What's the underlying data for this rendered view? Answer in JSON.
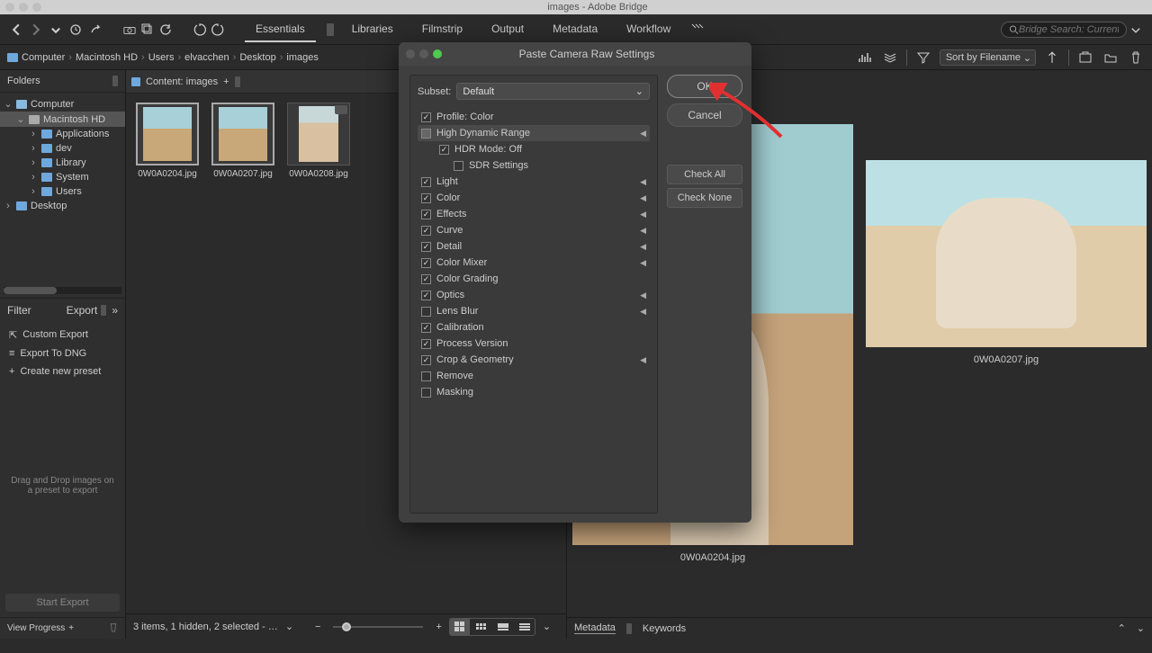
{
  "app": {
    "title": "images - Adobe Bridge"
  },
  "tabs": [
    "Essentials",
    "Libraries",
    "Filmstrip",
    "Output",
    "Metadata",
    "Workflow"
  ],
  "search": {
    "placeholder": "Bridge Search: Current …"
  },
  "breadcrumbs": [
    "Computer",
    "Macintosh HD",
    "Users",
    "elvacchen",
    "Desktop",
    "images"
  ],
  "sort": {
    "label": "Sort by Filename"
  },
  "folders": {
    "panel_title": "Folders",
    "tree": [
      {
        "name": "Computer",
        "depth": 0,
        "open": true,
        "icon": "computer"
      },
      {
        "name": "Macintosh HD",
        "depth": 1,
        "open": true,
        "icon": "drive"
      },
      {
        "name": "Applications",
        "depth": 2,
        "open": false,
        "icon": "folder"
      },
      {
        "name": "dev",
        "depth": 2,
        "open": false,
        "icon": "folder"
      },
      {
        "name": "Library",
        "depth": 2,
        "open": false,
        "icon": "folder"
      },
      {
        "name": "System",
        "depth": 2,
        "open": false,
        "icon": "folder"
      },
      {
        "name": "Users",
        "depth": 2,
        "open": false,
        "icon": "folder"
      },
      {
        "name": "Desktop",
        "depth": 0,
        "open": false,
        "icon": "folder"
      }
    ]
  },
  "filter_export": {
    "filter_label": "Filter",
    "export_label": "Export"
  },
  "export_presets": [
    {
      "label": "Custom Export"
    },
    {
      "label": "Export To DNG"
    },
    {
      "label": "Create new preset"
    }
  ],
  "export_hint": "Drag and Drop images on a preset to export",
  "start_export": "Start Export",
  "view_progress": "View Progress",
  "content": {
    "header": "Content: images",
    "thumbs": [
      {
        "name": "0W0A0204.jpg",
        "selected": true
      },
      {
        "name": "0W0A0207.jpg",
        "selected": true
      },
      {
        "name": "0W0A0208.jpg",
        "selected": false,
        "portrait": true,
        "gear": true
      }
    ]
  },
  "statusbar": {
    "text": "3 items, 1 hidden, 2 selected - …"
  },
  "preview": {
    "main_name": "0W0A0204.jpg",
    "side_name": "0W0A0207.jpg"
  },
  "metadata_tabs": [
    "Metadata",
    "Keywords"
  ],
  "dialog": {
    "title": "Paste Camera Raw Settings",
    "subset_label": "Subset:",
    "subset_value": "Default",
    "ok": "OK",
    "cancel": "Cancel",
    "check_all": "Check All",
    "check_none": "Check None",
    "items": [
      {
        "label": "Profile: Color",
        "checked": true,
        "tri": false
      },
      {
        "label": "High Dynamic Range",
        "checked": null,
        "tri": true,
        "header": true
      },
      {
        "label": "HDR Mode: Off",
        "checked": true,
        "sub": true
      },
      {
        "label": "SDR Settings",
        "checked": false,
        "subsub": true
      },
      {
        "label": "Light",
        "checked": true,
        "tri": true
      },
      {
        "label": "Color",
        "checked": true,
        "tri": true
      },
      {
        "label": "Effects",
        "checked": true,
        "tri": true
      },
      {
        "label": "Curve",
        "checked": true,
        "tri": true
      },
      {
        "label": "Detail",
        "checked": true,
        "tri": true
      },
      {
        "label": "Color Mixer",
        "checked": true,
        "tri": true
      },
      {
        "label": "Color Grading",
        "checked": true
      },
      {
        "label": "Optics",
        "checked": true,
        "tri": true
      },
      {
        "label": "Lens Blur",
        "checked": false,
        "tri": true
      },
      {
        "label": "Calibration",
        "checked": true
      },
      {
        "label": "Process Version",
        "checked": true
      },
      {
        "label": "Crop & Geometry",
        "checked": true,
        "tri": true
      },
      {
        "label": "Remove",
        "checked": false
      },
      {
        "label": "Masking",
        "checked": false
      }
    ]
  }
}
